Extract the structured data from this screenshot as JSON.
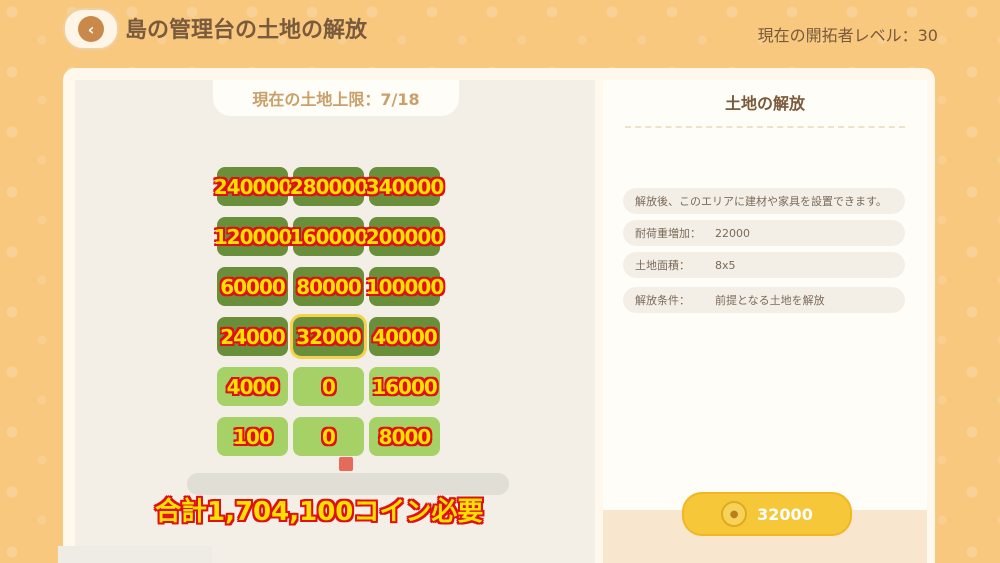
{
  "header": {
    "back_label": "‹",
    "title": "島の管理台の土地の解放",
    "level": "現在の開拓者レベル：30"
  },
  "left": {
    "limit": "現在の土地上限：7/18",
    "tiles": [
      {
        "value": "240000",
        "style": "dark"
      },
      {
        "value": "280000",
        "style": "dark"
      },
      {
        "value": "340000",
        "style": "dark"
      },
      {
        "value": "120000",
        "style": "dark"
      },
      {
        "value": "160000",
        "style": "dark"
      },
      {
        "value": "200000",
        "style": "dark"
      },
      {
        "value": "60000",
        "style": "dark"
      },
      {
        "value": "80000",
        "style": "dark"
      },
      {
        "value": "100000",
        "style": "dark"
      },
      {
        "value": "24000",
        "style": "dark"
      },
      {
        "value": "32000",
        "style": "selected"
      },
      {
        "value": "40000",
        "style": "dark"
      },
      {
        "value": "4000",
        "style": "light"
      },
      {
        "value": "0",
        "style": "light"
      },
      {
        "value": "16000",
        "style": "light"
      },
      {
        "value": "100",
        "style": "light"
      },
      {
        "value": "0",
        "style": "light"
      },
      {
        "value": "8000",
        "style": "light"
      }
    ],
    "total": "合計1,704,100コイン必要"
  },
  "right": {
    "title": "土地の解放",
    "description": "解放後、このエリアに建材や家具を設置できます。",
    "rows": [
      {
        "label": "耐荷重増加：",
        "value": "22000"
      },
      {
        "label": "土地面積：",
        "value": "8x5"
      },
      {
        "label": "解放条件：",
        "value": "前提となる土地を解放"
      }
    ],
    "cost": "32000"
  },
  "colors": {
    "background": "#f7c87e",
    "tile_dark": "#6a8f3a",
    "tile_light": "#a6d167",
    "button": "#f7c73a"
  }
}
